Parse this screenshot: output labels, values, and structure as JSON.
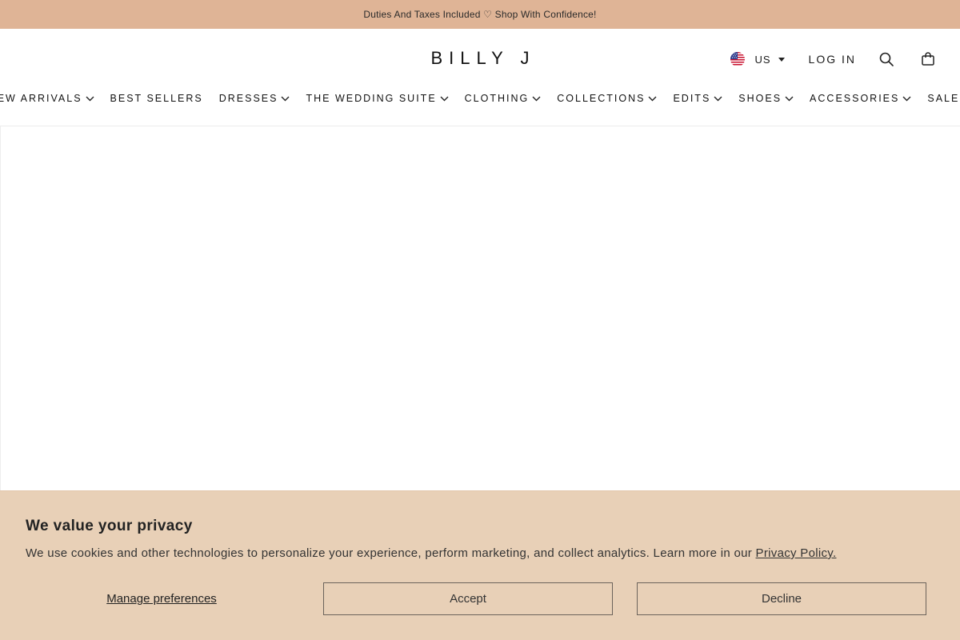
{
  "announcement": {
    "text": "Duties And Taxes Included ♡ Shop With Confidence!"
  },
  "header": {
    "logo": "BILLY J",
    "locale": {
      "label": "US",
      "flag": "us-flag-icon"
    },
    "login_label": "LOG IN",
    "icons": [
      "search-icon",
      "cart-bag-icon"
    ]
  },
  "nav": {
    "items": [
      {
        "label": "NEW ARRIVALS",
        "has_dropdown": true
      },
      {
        "label": "BEST SELLERS",
        "has_dropdown": false
      },
      {
        "label": "DRESSES",
        "has_dropdown": true
      },
      {
        "label": "THE WEDDING SUITE",
        "has_dropdown": true
      },
      {
        "label": "CLOTHING",
        "has_dropdown": true
      },
      {
        "label": "COLLECTIONS",
        "has_dropdown": true
      },
      {
        "label": "EDITS",
        "has_dropdown": true
      },
      {
        "label": "SHOES",
        "has_dropdown": true
      },
      {
        "label": "ACCESSORIES",
        "has_dropdown": true
      },
      {
        "label": "SALE",
        "has_dropdown": true
      }
    ]
  },
  "cookie_banner": {
    "title": "We value your privacy",
    "text": "We use cookies and other technologies to personalize your experience, perform marketing, and collect analytics. Learn more in our ",
    "policy_link": "Privacy Policy.",
    "manage_label": "Manage preferences",
    "accept_label": "Accept",
    "decline_label": "Decline"
  },
  "colors": {
    "announcement_bg": "#dfb496",
    "cookie_bg": "#e8d0b7",
    "text": "#1a1a1a"
  }
}
